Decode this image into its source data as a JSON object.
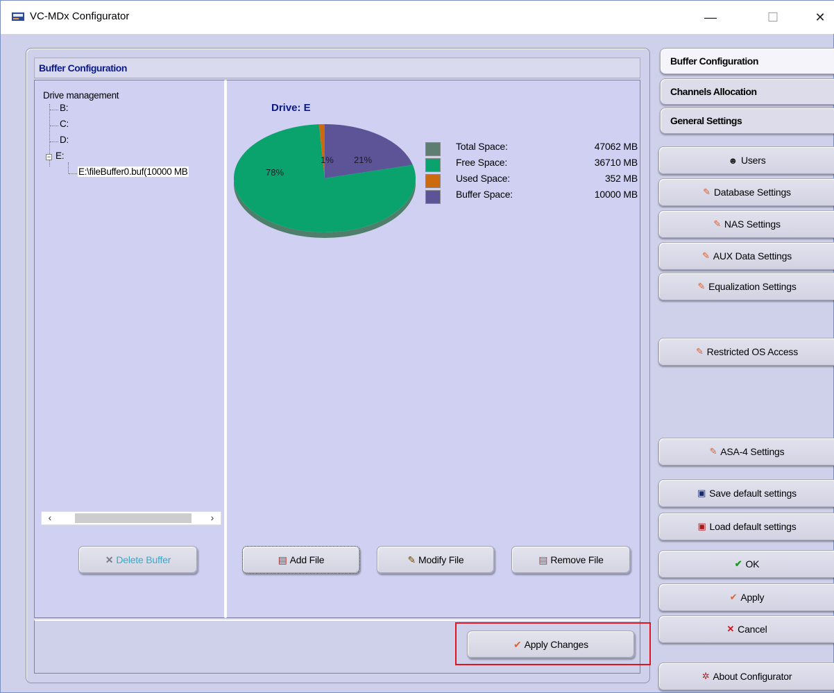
{
  "window": {
    "title": "VC-MDx Configurator",
    "controls": {
      "minimize": "—",
      "maximize": "☐",
      "close": "✕"
    }
  },
  "main": {
    "header": "Buffer Configuration",
    "tree": {
      "root": "Drive management",
      "items": [
        "B:",
        "C:",
        "D:",
        "E:"
      ],
      "expander": "−",
      "child": "E:\\fileBuffer0.buf(10000 MB"
    },
    "scroll": {
      "left": "‹",
      "right": "›"
    },
    "buttons": {
      "delete_buffer": "Delete Buffer",
      "add_file": "Add File",
      "modify_file": "Modify File",
      "remove_file": "Remove File",
      "apply_changes": "Apply Changes"
    }
  },
  "chart_data": {
    "type": "pie",
    "title": "Drive: E",
    "slices": [
      {
        "name": "Free Space",
        "percent": 78,
        "label": "78%",
        "color": "#0aa36e"
      },
      {
        "name": "Used Space",
        "percent": 1,
        "label": "1%",
        "color": "#cc6a10"
      },
      {
        "name": "Buffer Space",
        "percent": 21,
        "label": "21%",
        "color": "#5c5496"
      }
    ],
    "legend": [
      {
        "label": "Total Space:",
        "value": "47062 MB",
        "color": "#5e7e72"
      },
      {
        "label": "Free Space:",
        "value": "36710 MB",
        "color": "#0aa36e"
      },
      {
        "label": "Used Space:",
        "value": "352 MB",
        "color": "#cc6a10"
      },
      {
        "label": "Buffer Space:",
        "value": "10000 MB",
        "color": "#5c5496"
      }
    ],
    "legend_position": "right"
  },
  "sidebar": {
    "tabs": [
      "Buffer Configuration",
      "Channels Allocation",
      "General Settings"
    ],
    "active_tab": "Buffer Configuration",
    "buttons": {
      "users": "Users",
      "database": "Database Settings",
      "nas": "NAS Settings",
      "aux": "AUX Data Settings",
      "equalization": "Equalization Settings",
      "restricted": "Restricted OS Access",
      "asa4": "ASA-4 Settings",
      "save_default": "Save default settings",
      "load_default": "Load default settings",
      "ok": "OK",
      "apply": "Apply",
      "cancel": "Cancel",
      "about": "About  Configurator"
    }
  },
  "colors": {
    "accent_text": "#0a1a8a",
    "highlight": "#e0141e",
    "panel": "#cfd0f2"
  }
}
